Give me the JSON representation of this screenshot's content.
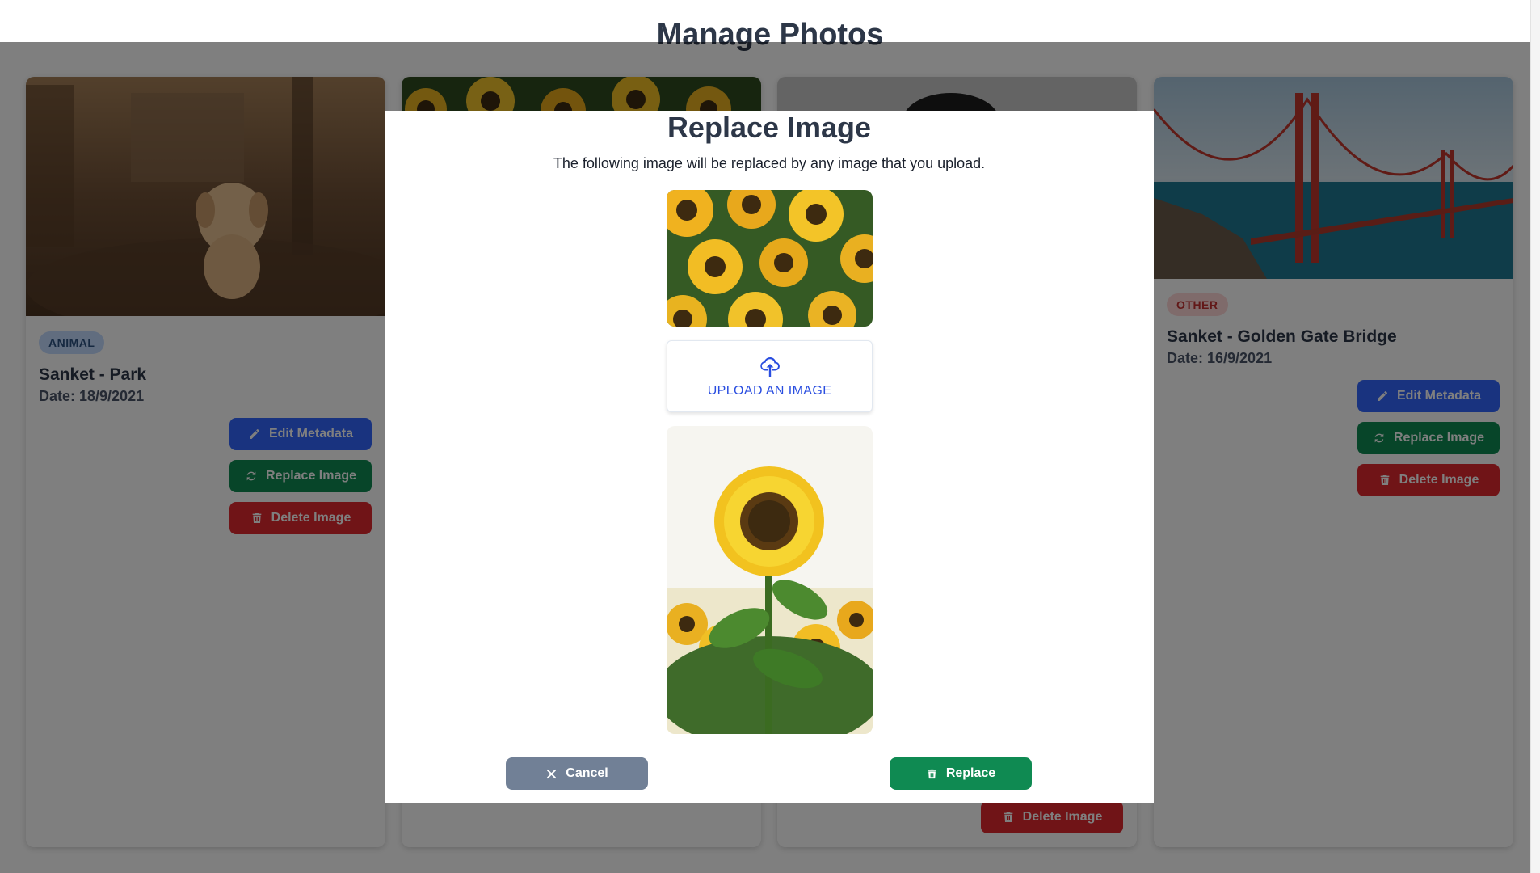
{
  "page": {
    "title": "Manage Photos"
  },
  "cards": [
    {
      "badge": "ANIMAL",
      "title": "Sanket - Park",
      "date": "Date: 18/9/2021",
      "buttons": {
        "edit": "Edit Metadata",
        "replace": "Replace Image",
        "delete": "Delete Image"
      }
    },
    {
      "badge": "",
      "title": "",
      "date": ""
    },
    {
      "badge": "",
      "title": "",
      "date": "",
      "buttons": {
        "delete": "Delete Image"
      }
    },
    {
      "badge": "OTHER",
      "title": "Sanket - Golden Gate Bridge",
      "date": "Date: 16/9/2021",
      "buttons": {
        "edit": "Edit Metadata",
        "replace": "Replace Image",
        "delete": "Delete Image"
      }
    }
  ],
  "modal": {
    "title": "Replace Image",
    "description": "The following image will be replaced by any image that you upload.",
    "upload_label": "UPLOAD AN IMAGE",
    "cancel_label": "Cancel",
    "replace_label": "Replace"
  },
  "colors": {
    "primary": "#3366ff",
    "success": "#0f8a52",
    "danger": "#e0282e",
    "neutral": "#718096",
    "heading": "#2d3748"
  },
  "icons": {
    "edit": "pencil-icon",
    "replace": "refresh-icon",
    "delete": "trash-icon",
    "upload": "cloud-upload-icon",
    "cancel": "close-icon"
  }
}
